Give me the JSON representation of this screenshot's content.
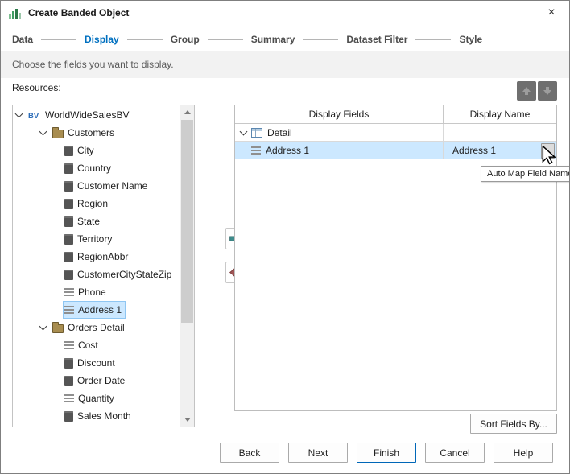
{
  "window": {
    "title": "Create Banded Object",
    "close_glyph": "×"
  },
  "steps": {
    "items": [
      {
        "label": "Data"
      },
      {
        "label": "Display",
        "active": true
      },
      {
        "label": "Group"
      },
      {
        "label": "Summary"
      },
      {
        "label": "Dataset Filter"
      },
      {
        "label": "Style"
      }
    ]
  },
  "subtitle": "Choose the fields you want to display.",
  "resources_label": "Resources:",
  "tree": {
    "items": [
      {
        "label": "WorldWideSalesBV",
        "icon": "icon-bv",
        "level": 0,
        "expandable": true
      },
      {
        "label": "Customers",
        "icon": "icon-folder",
        "level": 1,
        "expandable": true
      },
      {
        "label": "City",
        "icon": "icon-column",
        "level": 2
      },
      {
        "label": "Country",
        "icon": "icon-column",
        "level": 2
      },
      {
        "label": "Customer Name",
        "icon": "icon-column",
        "level": 2
      },
      {
        "label": "Region",
        "icon": "icon-column",
        "level": 2
      },
      {
        "label": "State",
        "icon": "icon-column",
        "level": 2
      },
      {
        "label": "Territory",
        "icon": "icon-column",
        "level": 2
      },
      {
        "label": "RegionAbbr",
        "icon": "icon-column",
        "level": 2
      },
      {
        "label": "CustomerCityStateZip",
        "icon": "icon-column",
        "level": 2
      },
      {
        "label": "Phone",
        "icon": "icon-lines",
        "level": 2
      },
      {
        "label": "Address 1",
        "icon": "icon-lines",
        "level": 2,
        "selected": true
      },
      {
        "label": "Orders Detail",
        "icon": "icon-folder",
        "level": 1,
        "expandable": true
      },
      {
        "label": "Cost",
        "icon": "icon-lines",
        "level": 2
      },
      {
        "label": "Discount",
        "icon": "icon-column",
        "level": 2
      },
      {
        "label": "Order Date",
        "icon": "icon-column",
        "level": 2
      },
      {
        "label": "Quantity",
        "icon": "icon-lines",
        "level": 2
      },
      {
        "label": "Sales Month",
        "icon": "icon-column",
        "level": 2
      }
    ]
  },
  "fields_table": {
    "columns": {
      "c1": "Display Fields",
      "c2": "Display Name"
    },
    "rows": [
      {
        "field": "Detail",
        "name": "",
        "icon": "icon-table",
        "group": true
      },
      {
        "field": "Address 1",
        "name": "Address 1",
        "icon": "icon-lines",
        "selected": true,
        "has_button": true
      }
    ]
  },
  "tooltip": "Auto Map Field Name",
  "buttons": {
    "sort": "Sort Fields By...",
    "back": "Back",
    "next": "Next",
    "finish": "Finish",
    "cancel": "Cancel",
    "help": "Help"
  },
  "colors": {
    "accent": "#0070C0",
    "selection": "#CCE8FF",
    "arrow_right": "#3E8C8C",
    "arrow_left": "#A05454"
  }
}
